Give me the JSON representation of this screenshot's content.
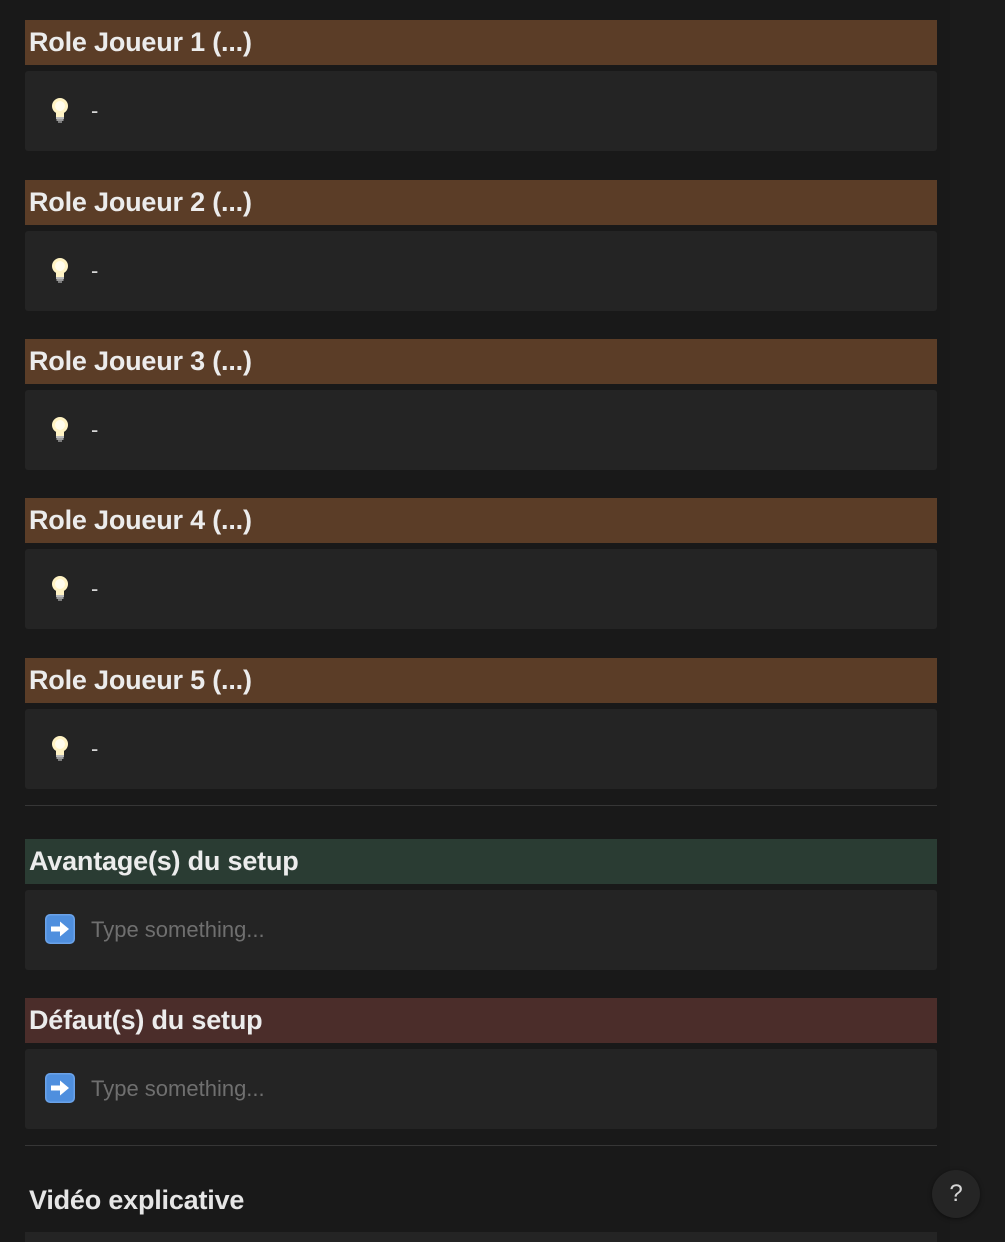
{
  "roles": [
    {
      "title": "Role Joueur 1 (...)",
      "text": "-"
    },
    {
      "title": "Role Joueur 2 (...)",
      "text": "-"
    },
    {
      "title": "Role Joueur 3 (...)",
      "text": "-"
    },
    {
      "title": "Role Joueur 4 (...)",
      "text": "-"
    },
    {
      "title": "Role Joueur 5 (...)",
      "text": "-"
    }
  ],
  "advantages": {
    "title": "Avantage(s) du setup",
    "placeholder": "Type something..."
  },
  "defects": {
    "title": "Défaut(s) du setup",
    "placeholder": "Type something..."
  },
  "video": {
    "title": "Vidéo explicative"
  },
  "help_button": {
    "label": "?"
  },
  "icons": {
    "role_callout": "lightbulb-icon",
    "setup_callout": "right-arrow-icon"
  },
  "colors": {
    "role_heading_bg": "#5b3d27",
    "advantages_heading_bg": "#2a3c33",
    "defects_heading_bg": "#4b2d2a"
  }
}
